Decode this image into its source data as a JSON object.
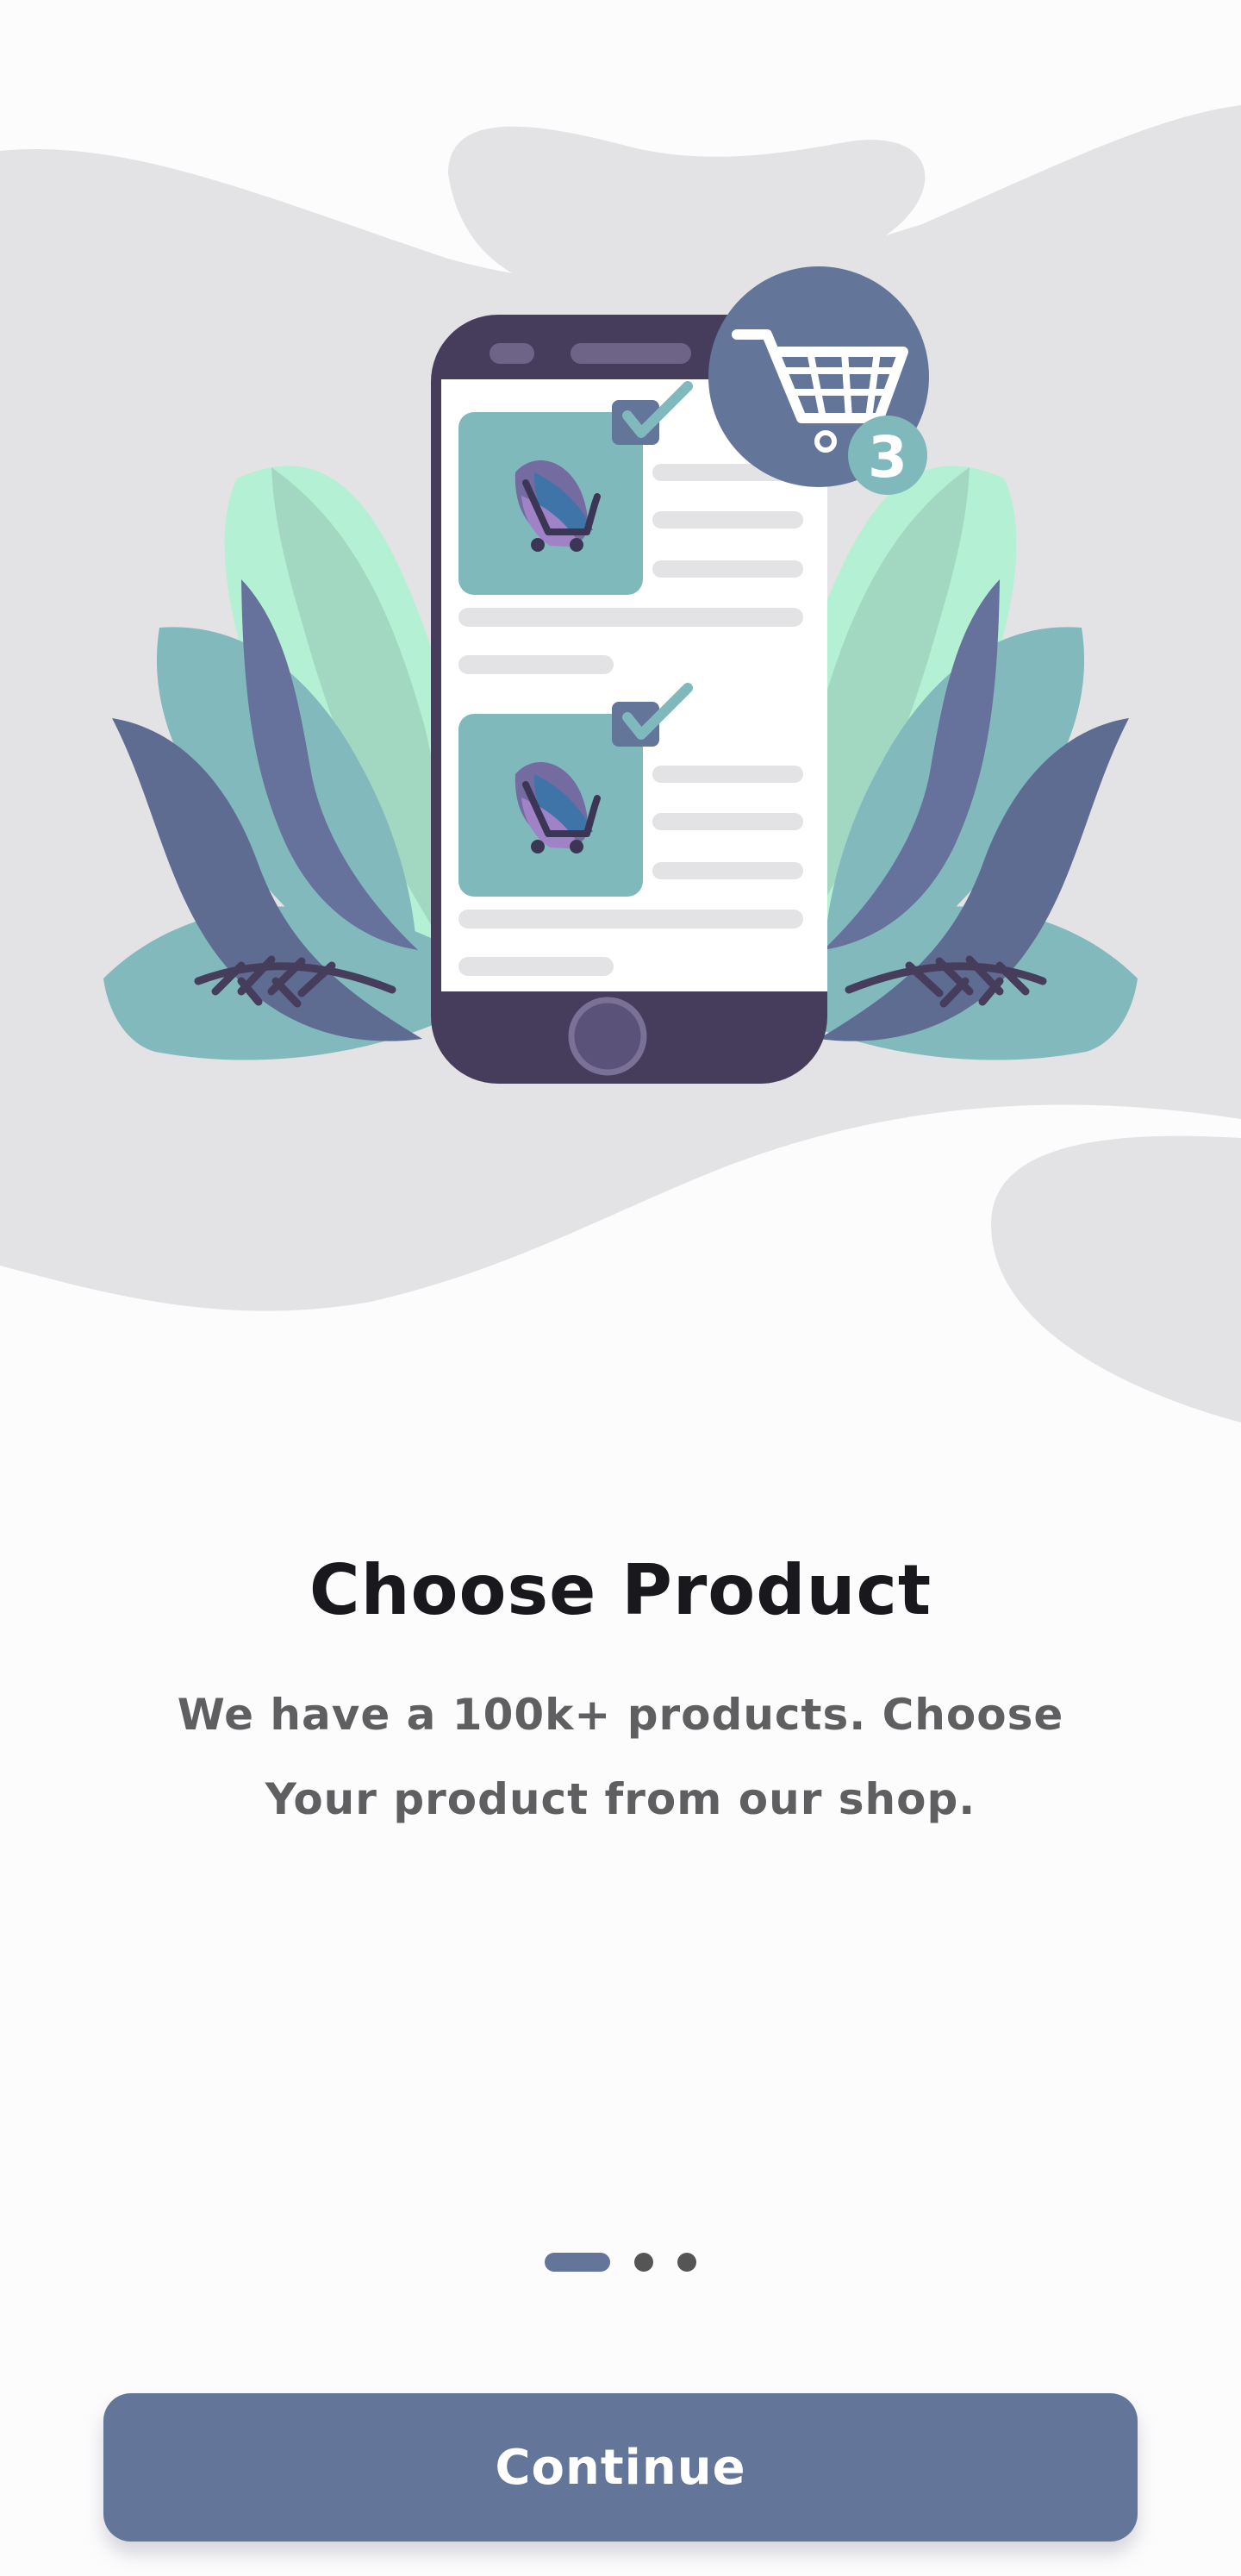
{
  "onboarding": {
    "title": "Choose Product",
    "description": "We have a 100k+ products. Choose Your product from our shop.",
    "continue_label": "Continue",
    "cart_count": "3",
    "active_page": 1,
    "page_count": 3
  },
  "illustration": {
    "background_blob_color": "#e3e3e5",
    "phone_color": "#463d5d",
    "card_color": "#80b9bc",
    "leaf_colors": [
      "#b4f1d4",
      "#82b9bc",
      "#5f6c92"
    ],
    "icons": [
      "phone-illustration",
      "cart-icon",
      "checkmark-icon",
      "leaf-decoration"
    ]
  },
  "colors": {
    "accent": "#637599",
    "title_text": "#19191d",
    "body_text": "#5f5f62",
    "inactive_dot": "#555555",
    "background": "#fdfcfd"
  }
}
